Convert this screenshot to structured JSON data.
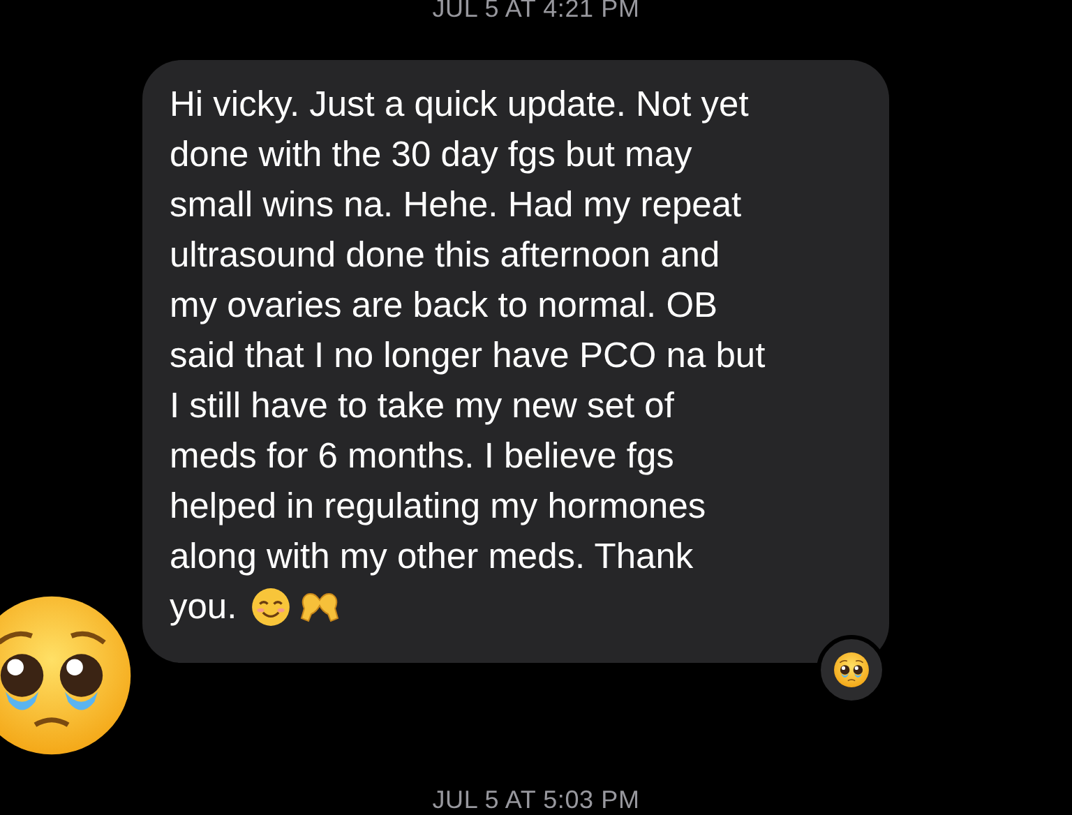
{
  "top_timestamp": "JUL 5 AT 4:21 PM",
  "message": {
    "lines": [
      "Hi vicky. Just a quick update. Not yet",
      "done with the 30 day fgs but may",
      "small wins na. Hehe. Had my repeat",
      "ultrasound done this afternoon and",
      "my ovaries are back to normal. OB",
      "said that I no longer have PCO na but",
      "I still have to take my new set of",
      "meds for 6 months. I believe fgs",
      "helped in regulating my hormones",
      "along with my other meds. Thank",
      "you."
    ]
  },
  "bottom_timestamp": "JUL 5 AT 5:03 PM"
}
